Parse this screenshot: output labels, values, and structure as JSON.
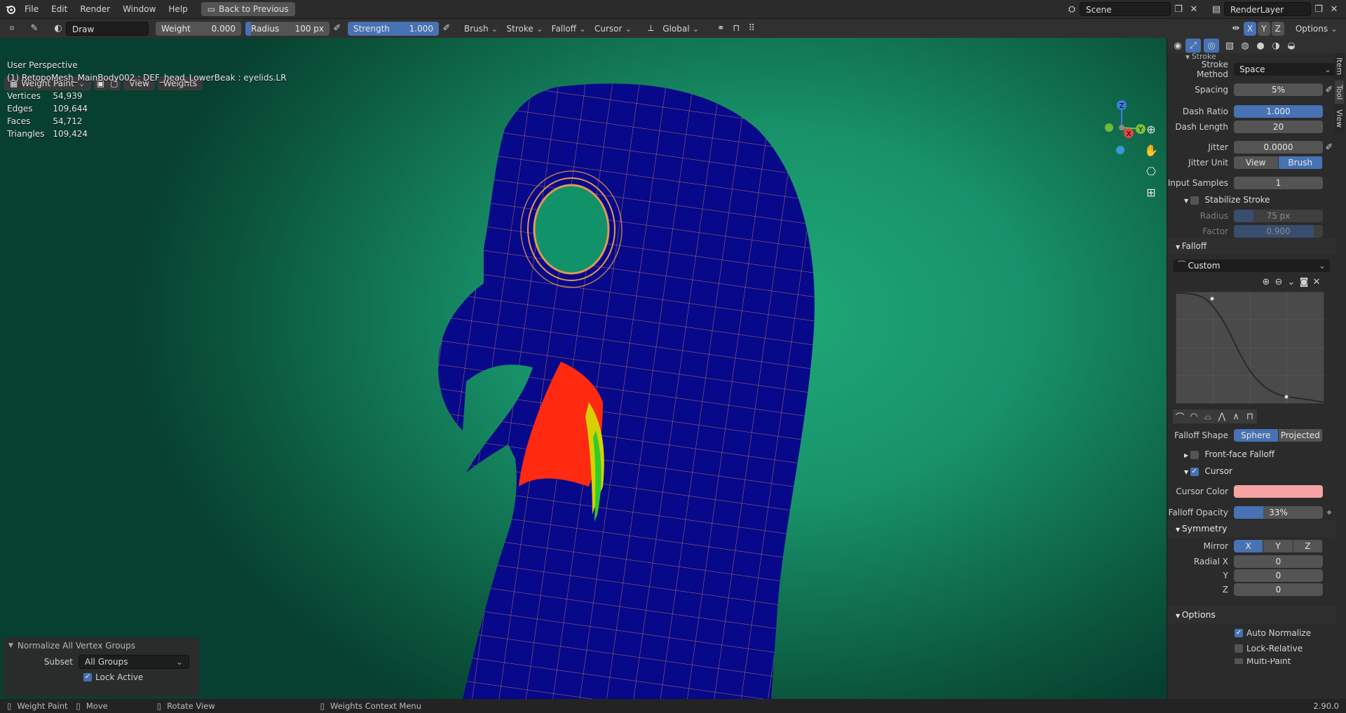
{
  "topbar": {
    "menu": [
      "File",
      "Edit",
      "Render",
      "Window",
      "Help"
    ],
    "back_button": "Back to Previous",
    "scene": "Scene",
    "render_layer": "RenderLayer"
  },
  "toolheader": {
    "brush_name": "Draw",
    "weight_label": "Weight",
    "weight_value": "0.000",
    "radius_label": "Radius",
    "radius_value": "100 px",
    "strength_label": "Strength",
    "strength_value": "1.000",
    "strength_fill": 1.0,
    "radius_fill": 0.07,
    "menus": [
      "Brush",
      "Stroke",
      "Falloff",
      "Cursor"
    ],
    "orientation": "Global",
    "axes": [
      "X",
      "Y",
      "Z"
    ],
    "options": "Options"
  },
  "vpheader": {
    "mode": "Weight Paint",
    "view": "View",
    "weights": "Weights"
  },
  "overlay": {
    "perspective": "User Perspective",
    "object_info": "(1) RetopoMesh_MainBody002 : DEF_head_LowerBeak : eyelids.LR",
    "stats": [
      {
        "label": "Vertices",
        "value": "54,939"
      },
      {
        "label": "Edges",
        "value": "109,644"
      },
      {
        "label": "Faces",
        "value": "54,712"
      },
      {
        "label": "Triangles",
        "value": "109,424"
      }
    ]
  },
  "gizmo": {
    "x": "X",
    "y": "Y",
    "z": "Z"
  },
  "operator_panel": {
    "title": "Normalize All Vertex Groups",
    "subset_label": "Subset",
    "subset_value": "All Groups",
    "lock_active": "Lock Active"
  },
  "sidebar": {
    "stroke_header": "Stroke",
    "stroke_method_label": "Stroke Method",
    "stroke_method_value": "Space",
    "spacing_label": "Spacing",
    "spacing_value": "5%",
    "dash_ratio_label": "Dash Ratio",
    "dash_ratio_value": "1.000",
    "dash_length_label": "Dash Length",
    "dash_length_value": "20",
    "jitter_label": "Jitter",
    "jitter_value": "0.0000",
    "jitter_unit_label": "Jitter Unit",
    "jitter_unit_view": "View",
    "jitter_unit_brush": "Brush",
    "input_samples_label": "Input Samples",
    "input_samples_value": "1",
    "stabilize_label": "Stabilize Stroke",
    "stab_radius_label": "Radius",
    "stab_radius_value": "75 px",
    "stab_factor_label": "Factor",
    "stab_factor_value": "0.900",
    "stab_factor_fill": 0.9,
    "falloff_header": "Falloff",
    "falloff_preset": "Custom",
    "falloff_shape_label": "Falloff Shape",
    "falloff_sphere": "Sphere",
    "falloff_projected": "Projected",
    "front_face_label": "Front-face Falloff",
    "cursor_label": "Cursor",
    "cursor_color_label": "Cursor Color",
    "cursor_color": "#f5a3a3",
    "falloff_opacity_label": "Falloff Opacity",
    "falloff_opacity_value": "33%",
    "falloff_opacity_fill": 0.33,
    "symmetry_header": "Symmetry",
    "mirror_label": "Mirror",
    "mirror_x": "X",
    "mirror_y": "Y",
    "mirror_z": "Z",
    "radial_x_label": "Radial X",
    "radial_x_value": "0",
    "radial_y_label": "Y",
    "radial_y_value": "0",
    "radial_z_label": "Z",
    "radial_z_value": "0",
    "options_header": "Options",
    "auto_normalize": "Auto Normalize",
    "lock_relative": "Lock-Relative",
    "multi_paint": "Multi-Paint",
    "tabs": [
      "Item",
      "Tool",
      "View"
    ]
  },
  "statusbar": {
    "mode": "Weight Paint",
    "move": "Move",
    "rotate": "Rotate View",
    "context": "Weights Context Menu",
    "version": "2.90.0"
  },
  "colors": {
    "accent": "#4772b3",
    "mesh_blue": "#08088a",
    "wire": "#e09a4e",
    "weight_red": "#ff2a10"
  }
}
